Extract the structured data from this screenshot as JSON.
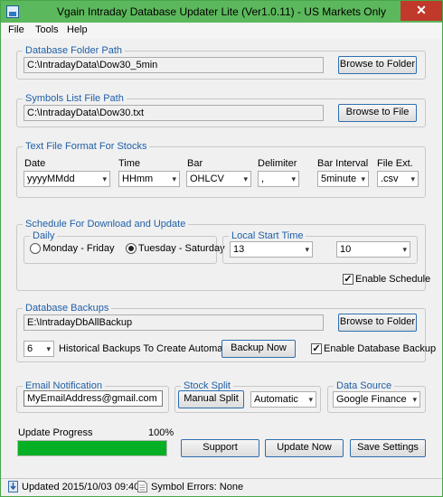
{
  "window": {
    "title": "Vgain Intraday Database Updater Lite (Ver1.0.11) - US Markets Only",
    "close_glyph": "✕"
  },
  "menu": [
    "File",
    "Tools",
    "Help"
  ],
  "database_folder": {
    "legend": "Database Folder Path",
    "path": "C:\\IntradayData\\Dow30_5min",
    "browse_label": "Browse to Folder"
  },
  "symbols_file": {
    "legend": "Symbols List File Path",
    "path": "C:\\IntradayData\\Dow30.txt",
    "browse_label": "Browse to File"
  },
  "text_format": {
    "legend": "Text File Format For Stocks",
    "fields": [
      {
        "label": "Date",
        "value": "yyyyMMdd"
      },
      {
        "label": "Time",
        "value": "HHmm"
      },
      {
        "label": "Bar",
        "value": "OHLCV"
      },
      {
        "label": "Delimiter",
        "value": ","
      },
      {
        "label": "Bar Interval",
        "value": "5minute"
      },
      {
        "label": "File Ext.",
        "value": ".csv"
      }
    ]
  },
  "schedule": {
    "legend": "Schedule For Download and Update",
    "daily_legend": "Daily",
    "option_1": "Monday - Friday",
    "option_2": "Tuesday - Saturday",
    "selected": "Tuesday - Saturday",
    "local_start_legend": "Local Start Time",
    "hour": "13",
    "minute": "10",
    "enable_label": "Enable Schedule",
    "enable_checked": true
  },
  "backups": {
    "legend": "Database Backups",
    "path": "E:\\IntradayDbAllBackup",
    "browse_label": "Browse to Folder",
    "count": "6",
    "historical_label": "Historical Backups To Create Automatically",
    "backup_now_label": "Backup Now",
    "enable_label": "Enable Database Backup",
    "enable_checked": true
  },
  "email": {
    "legend": "Email Notification",
    "value": "MyEmailAddress@gmail.com"
  },
  "stock_split": {
    "legend": "Stock Split",
    "manual_label": "Manual Split",
    "mode": "Automatic"
  },
  "data_source": {
    "legend": "Data Source",
    "value": "Google Finance"
  },
  "progress": {
    "label": "Update Progress",
    "percent_text": "100%",
    "fraction": 1.0,
    "color": "#06b025"
  },
  "buttons": {
    "support": "Support",
    "update_now": "Update Now",
    "save_settings": "Save Settings"
  },
  "status": {
    "updated": "Updated 2015/10/03 09:40",
    "symbol_errors": "Symbol Errors: None"
  },
  "check_glyph": "✓",
  "caret_glyph": "▾"
}
